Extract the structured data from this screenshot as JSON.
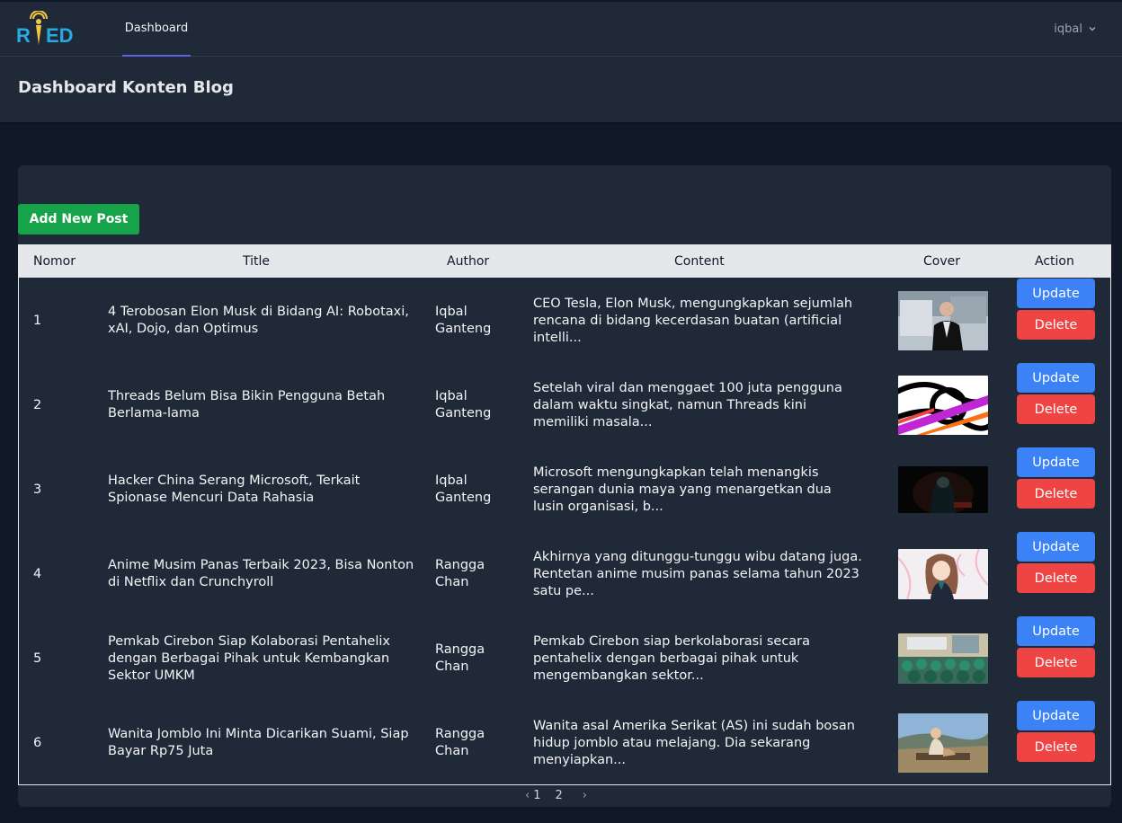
{
  "brand": {
    "logo_text": "RED",
    "accent": "#f2c744",
    "accent2": "#27a9e1"
  },
  "nav": {
    "dashboard": "Dashboard",
    "user": "iqbal"
  },
  "header": {
    "title": "Dashboard Konten Blog"
  },
  "toolbar": {
    "add_label": "Add New Post"
  },
  "table": {
    "columns": {
      "nomor": "Nomor",
      "title": "Title",
      "author": "Author",
      "content": "Content",
      "cover": "Cover",
      "action": "Action"
    },
    "rows": [
      {
        "num": "1",
        "title": "4 Terobosan Elon Musk di Bidang AI: Robotaxi, xAI, Dojo, dan Optimus",
        "author": "Iqbal Ganteng",
        "content": "CEO Tesla, Elon Musk, mengungkapkan sejumlah rencana di bidang kecerdasan buatan (artificial intelli...",
        "cover": "portrait-photo"
      },
      {
        "num": "2",
        "title": "Threads Belum Bisa Bikin Pengguna Betah Berlama-lama",
        "author": "Iqbal Ganteng",
        "content": "Setelah viral dan menggaet 100 juta pengguna dalam waktu singkat, namun Threads kini memiliki masala...",
        "cover": "threads-logo"
      },
      {
        "num": "3",
        "title": "Hacker China Serang Microsoft, Terkait Spionase Mencuri Data Rahasia",
        "author": "Iqbal Ganteng",
        "content": "Microsoft mengungkapkan telah menangkis serangan dunia maya yang menargetkan dua lusin organisasi, b...",
        "cover": "hacker-photo"
      },
      {
        "num": "4",
        "title": "Anime Musim Panas Terbaik 2023, Bisa Nonton di Netflix dan Crunchyroll",
        "author": "Rangga Chan",
        "content": "Akhirnya yang ditunggu-tunggu wibu datang juga. Rentetan anime musim panas selama tahun 2023 satu pe...",
        "cover": "anime-illustration"
      },
      {
        "num": "5",
        "title": "Pemkab Cirebon Siap Kolaborasi Pentahelix dengan Berbagai Pihak untuk Kembangkan Sektor UMKM",
        "author": "Rangga Chan",
        "content": "Pemkab Cirebon siap berkolaborasi secara pentahelix dengan berbagai pihak untuk mengembangkan sektor...",
        "cover": "meeting-photo"
      },
      {
        "num": "6",
        "title": "Wanita Jomblo Ini Minta Dicarikan Suami, Siap Bayar Rp75 Juta",
        "author": "Rangga Chan",
        "content": "Wanita asal Amerika Serikat (AS) ini sudah bosan hidup jomblo atau melajang. Dia sekarang menyiapkan...",
        "cover": "outdoor-photo"
      }
    ],
    "update_label": "Update",
    "delete_label": "Delete"
  },
  "pagination": {
    "prev": "‹",
    "pages": [
      "1",
      "2"
    ],
    "next": "›"
  }
}
